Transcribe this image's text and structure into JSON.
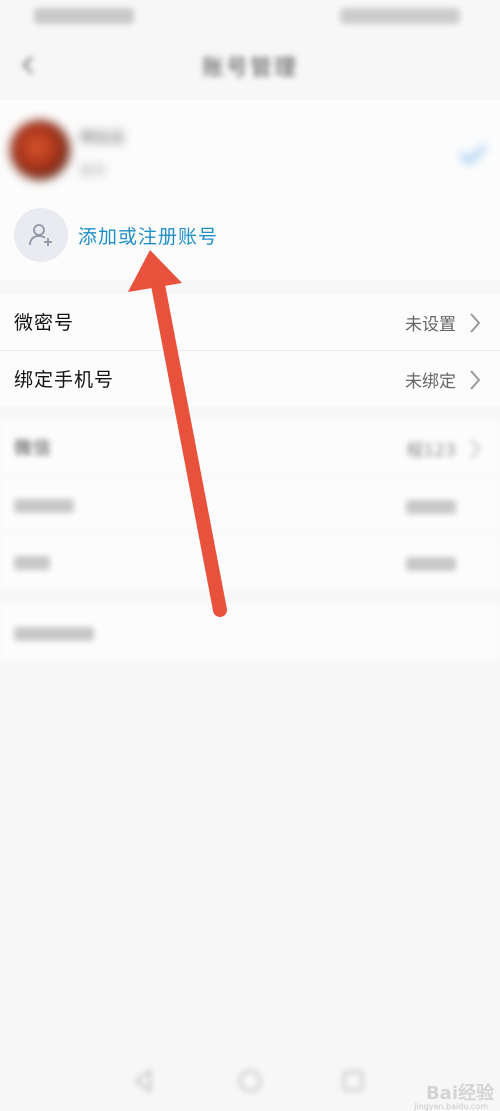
{
  "nav": {
    "title": "账号管理"
  },
  "account": {
    "name": "林云云",
    "sub": "账号"
  },
  "add_account": {
    "label": "添加或注册账号"
  },
  "settings_group1": [
    {
      "label": "微密号",
      "value": "未设置"
    },
    {
      "label": "绑定手机号",
      "value": "未绑定"
    }
  ],
  "settings_group2": [
    {
      "label": "微信",
      "value": "程123"
    },
    {
      "label": "",
      "value": ""
    },
    {
      "label": "",
      "value": ""
    }
  ],
  "logout": {
    "label": ""
  },
  "watermark": {
    "text": "Bai经验",
    "sub": "jingyan.baidu.com"
  },
  "colors": {
    "accent": "#1f8fc8",
    "arrow": "#e8513c",
    "check": "#5aa8e8"
  }
}
